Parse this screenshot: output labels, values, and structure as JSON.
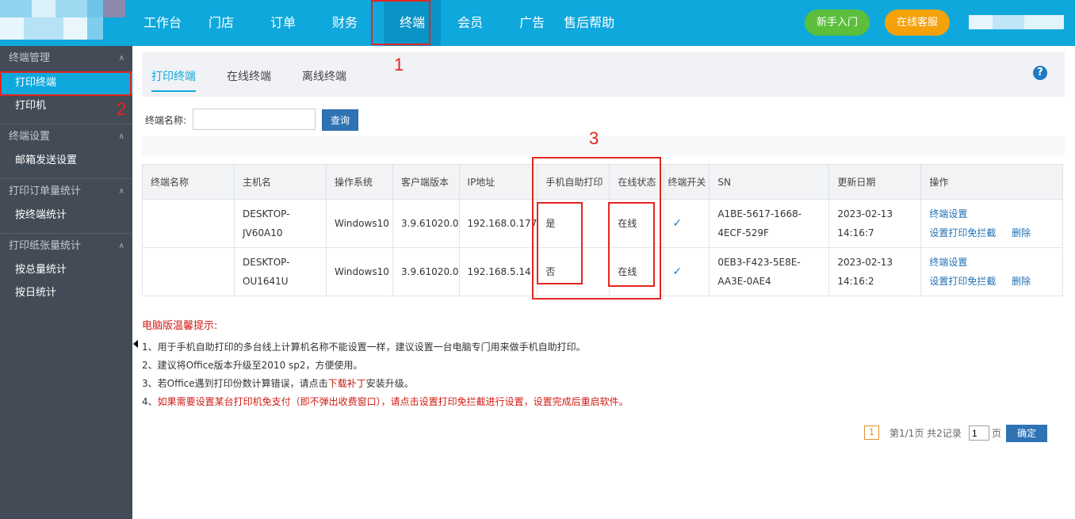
{
  "topnav": {
    "items": [
      "工作台",
      "门店",
      "订单",
      "财务",
      "终端",
      "会员",
      "广告",
      "售后帮助"
    ],
    "active_index": 4,
    "guide_button": "新手入门",
    "service_button": "在线客服"
  },
  "sidebar": {
    "groups": [
      {
        "title": "终端管理",
        "items": [
          "打印终端",
          "打印机"
        ]
      },
      {
        "title": "终端设置",
        "items": [
          "邮箱发送设置"
        ]
      },
      {
        "title": "打印订单量统计",
        "items": [
          "按终端统计"
        ]
      },
      {
        "title": "打印纸张量统计",
        "items": [
          "按总量统计",
          "按日统计"
        ]
      }
    ],
    "active_item": "打印终端"
  },
  "tabs": [
    "打印终端",
    "在线终端",
    "离线终端"
  ],
  "search": {
    "label": "终端名称:",
    "value": "",
    "button": "查询"
  },
  "table": {
    "headers": [
      "终端名称",
      "主机名",
      "操作系统",
      "客户端版本",
      "IP地址",
      "手机自助打印",
      "在线状态",
      "终端开关",
      "SN",
      "更新日期",
      "操作"
    ],
    "rows": [
      {
        "terminal_name": "",
        "host_line1": "DESKTOP-",
        "host_line2": "JV60A10",
        "os": "Windows10",
        "version": "3.9.61020.0",
        "ip": "192.168.0.177",
        "self_print": "是",
        "status": "在线",
        "switch": "✓",
        "sn_line1": "A1BE-5617-1668-",
        "sn_line2": "4ECF-529F",
        "date_line1": "2023-02-13",
        "date_line2": "14:16:7",
        "op_settings": "终端设置",
        "op_block": "设置打印免拦截",
        "op_delete": "删除"
      },
      {
        "terminal_name": "",
        "host_line1": "DESKTOP-",
        "host_line2": "OU1641U",
        "os": "Windows10",
        "version": "3.9.61020.0",
        "ip": "192.168.5.14",
        "self_print": "否",
        "status": "在线",
        "switch": "✓",
        "sn_line1": "0EB3-F423-5E8E-",
        "sn_line2": "AA3E-0AE4",
        "date_line1": "2023-02-13",
        "date_line2": "14:16:2",
        "op_settings": "终端设置",
        "op_block": "设置打印免拦截",
        "op_delete": "删除"
      }
    ]
  },
  "tips": {
    "title": "电脑版温馨提示:",
    "line1": "1、用于手机自助打印的多台线上计算机名称不能设置一样，建议设置一台电脑专门用来做手机自助打印。",
    "line2": "2、建议将Office版本升级至2010 sp2，方便使用。",
    "line3_pre": "3、若Office遇到打印份数计算错误，请点击",
    "line3_link": "下载补丁",
    "line3_post": "安装升级。",
    "line4": "4、如果需要设置某台打印机免支付（即不弹出收费窗口），请点击设置打印免拦截进行设置，设置完成后重启软件。"
  },
  "pager": {
    "current": "1",
    "summary": "第1/1页 共2记录",
    "input_value": "1",
    "unit": "页",
    "confirm": "确定"
  },
  "annotations": [
    "1",
    "2",
    "3"
  ],
  "colors": {
    "topbar": "#0fa8dc",
    "sidebar": "#434b57",
    "accent_blue": "#2f73b5",
    "annotation_red": "#e4251f"
  }
}
